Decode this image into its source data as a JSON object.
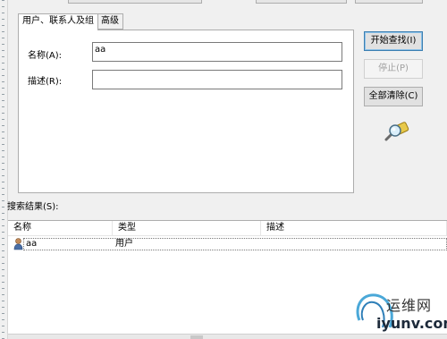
{
  "tabs": {
    "users_contacts_groups": "用户、联系人及组",
    "advanced": "高级"
  },
  "form": {
    "name_label": "名称(A):",
    "name_value": "aa",
    "description_label": "描述(R):",
    "description_value": ""
  },
  "buttons": {
    "start_search": "开始查找(I)",
    "stop": "停止(P)",
    "clear_all": "全部清除(C)"
  },
  "results": {
    "label": "搜索结果(S):",
    "columns": [
      "名称",
      "类型",
      "描述"
    ],
    "rows": [
      {
        "name": "aa",
        "type": "用户",
        "description": ""
      }
    ]
  },
  "watermark": {
    "title": "运维网",
    "domain": "iyunv.com"
  },
  "icons": {
    "search_glass": "magnifier-icon",
    "user": "user-icon"
  },
  "colors": {
    "window_bg": "#f0f0f0",
    "primary_border": "#3c7fb1",
    "disabled_text": "#a0a0a0"
  }
}
